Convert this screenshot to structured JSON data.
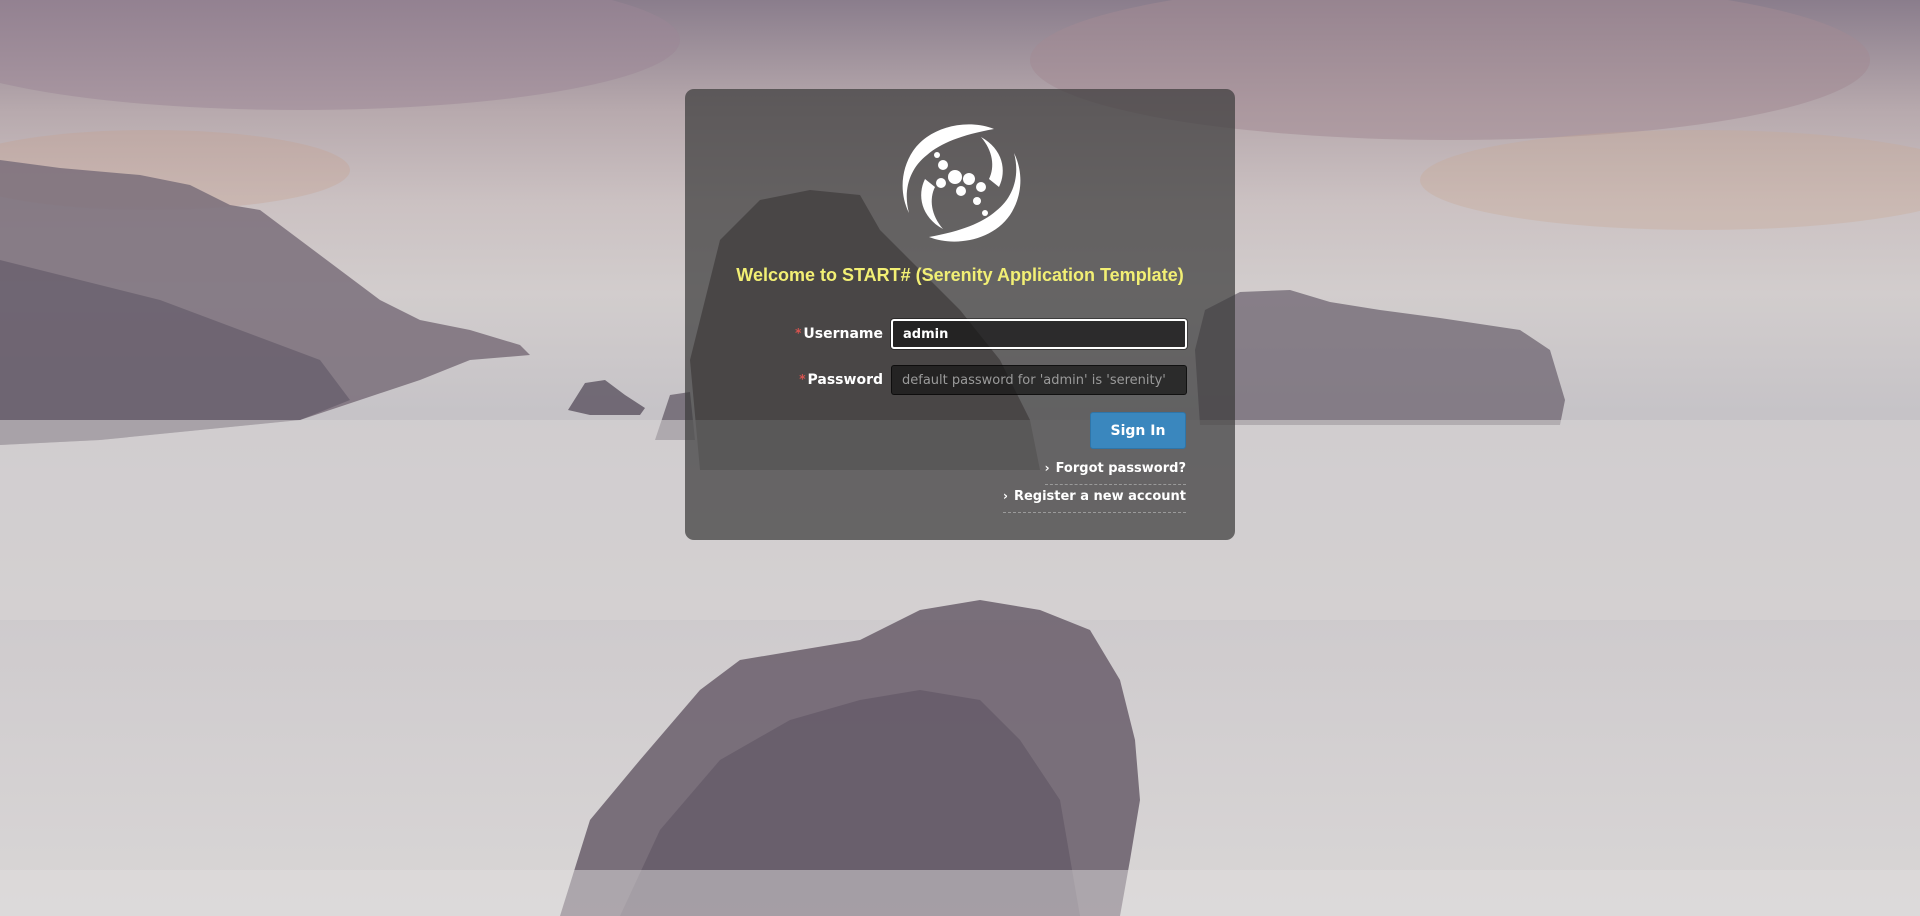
{
  "app": {
    "welcome_title": "Welcome to START# (Serenity Application Template)"
  },
  "login_form": {
    "username_label": "Username",
    "username_value": "admin",
    "password_label": "Password",
    "password_placeholder": "default password for 'admin' is 'serenity'",
    "required_marker": "*",
    "signin_label": "Sign In"
  },
  "links": {
    "forgot_password": "Forgot password?",
    "register": "Register a new account",
    "chevron": "›"
  },
  "icons": {
    "logo": "serenity-logo-icon",
    "link_chevron": "chevron-right-icon"
  },
  "colors": {
    "title": "#f2ef74",
    "signin_button": "#3a87be",
    "panel": "rgba(60,60,60,0.72)",
    "required": "#d9534f"
  }
}
